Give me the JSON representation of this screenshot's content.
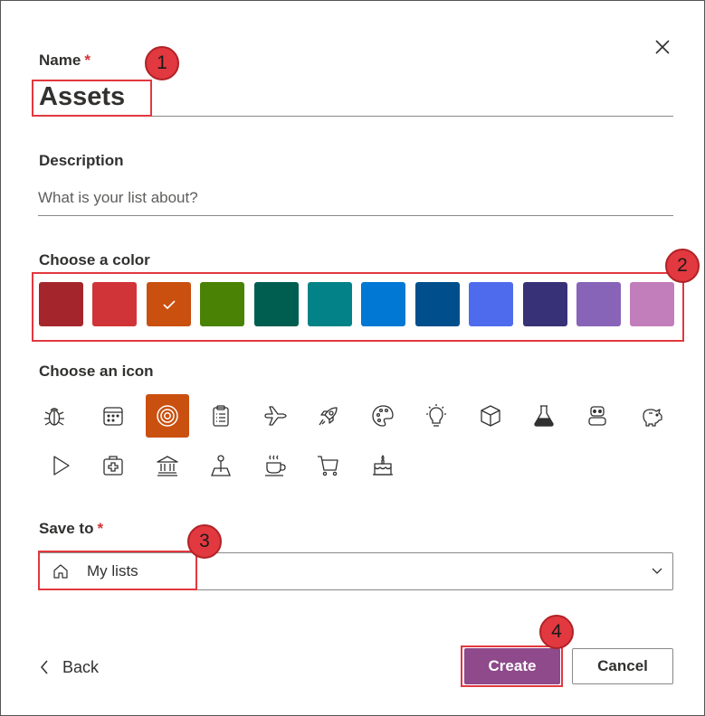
{
  "form": {
    "name_label": "Name",
    "required_mark": "*",
    "name_value": "Assets",
    "description_label": "Description",
    "description_placeholder": "What is your list about?",
    "color_label": "Choose a color",
    "icon_label": "Choose an icon",
    "save_label": "Save to",
    "save_value": "My lists"
  },
  "colors": [
    {
      "name": "dark-red",
      "hex": "#a4262c"
    },
    {
      "name": "red",
      "hex": "#d13438"
    },
    {
      "name": "orange",
      "hex": "#ca5010",
      "selected": true
    },
    {
      "name": "green",
      "hex": "#498205"
    },
    {
      "name": "dark-teal",
      "hex": "#005e50"
    },
    {
      "name": "teal",
      "hex": "#038387"
    },
    {
      "name": "blue",
      "hex": "#0078d4"
    },
    {
      "name": "dark-blue",
      "hex": "#004e8c"
    },
    {
      "name": "light-blue",
      "hex": "#4f6bed"
    },
    {
      "name": "navy",
      "hex": "#373277"
    },
    {
      "name": "purple",
      "hex": "#8764b8"
    },
    {
      "name": "pink",
      "hex": "#c27dbb"
    }
  ],
  "icons": [
    {
      "name": "bug-icon"
    },
    {
      "name": "calendar-icon"
    },
    {
      "name": "target-icon",
      "selected": true
    },
    {
      "name": "clipboard-list-icon"
    },
    {
      "name": "airplane-icon"
    },
    {
      "name": "rocket-icon"
    },
    {
      "name": "palette-icon"
    },
    {
      "name": "lightbulb-icon"
    },
    {
      "name": "cube-icon"
    },
    {
      "name": "beaker-icon"
    },
    {
      "name": "robot-icon"
    },
    {
      "name": "piggy-bank-icon"
    },
    {
      "name": "play-icon"
    },
    {
      "name": "first-aid-kit-icon"
    },
    {
      "name": "bank-icon"
    },
    {
      "name": "map-pin-icon"
    },
    {
      "name": "coffee-cup-icon"
    },
    {
      "name": "shopping-cart-icon"
    },
    {
      "name": "cake-icon"
    }
  ],
  "actions": {
    "back_label": "Back",
    "create_label": "Create",
    "cancel_label": "Cancel"
  },
  "callouts": [
    "1",
    "2",
    "3",
    "4"
  ],
  "theme": {
    "accent": "#8f4a8b",
    "highlight": "#e2383f",
    "required": "#d13438"
  }
}
